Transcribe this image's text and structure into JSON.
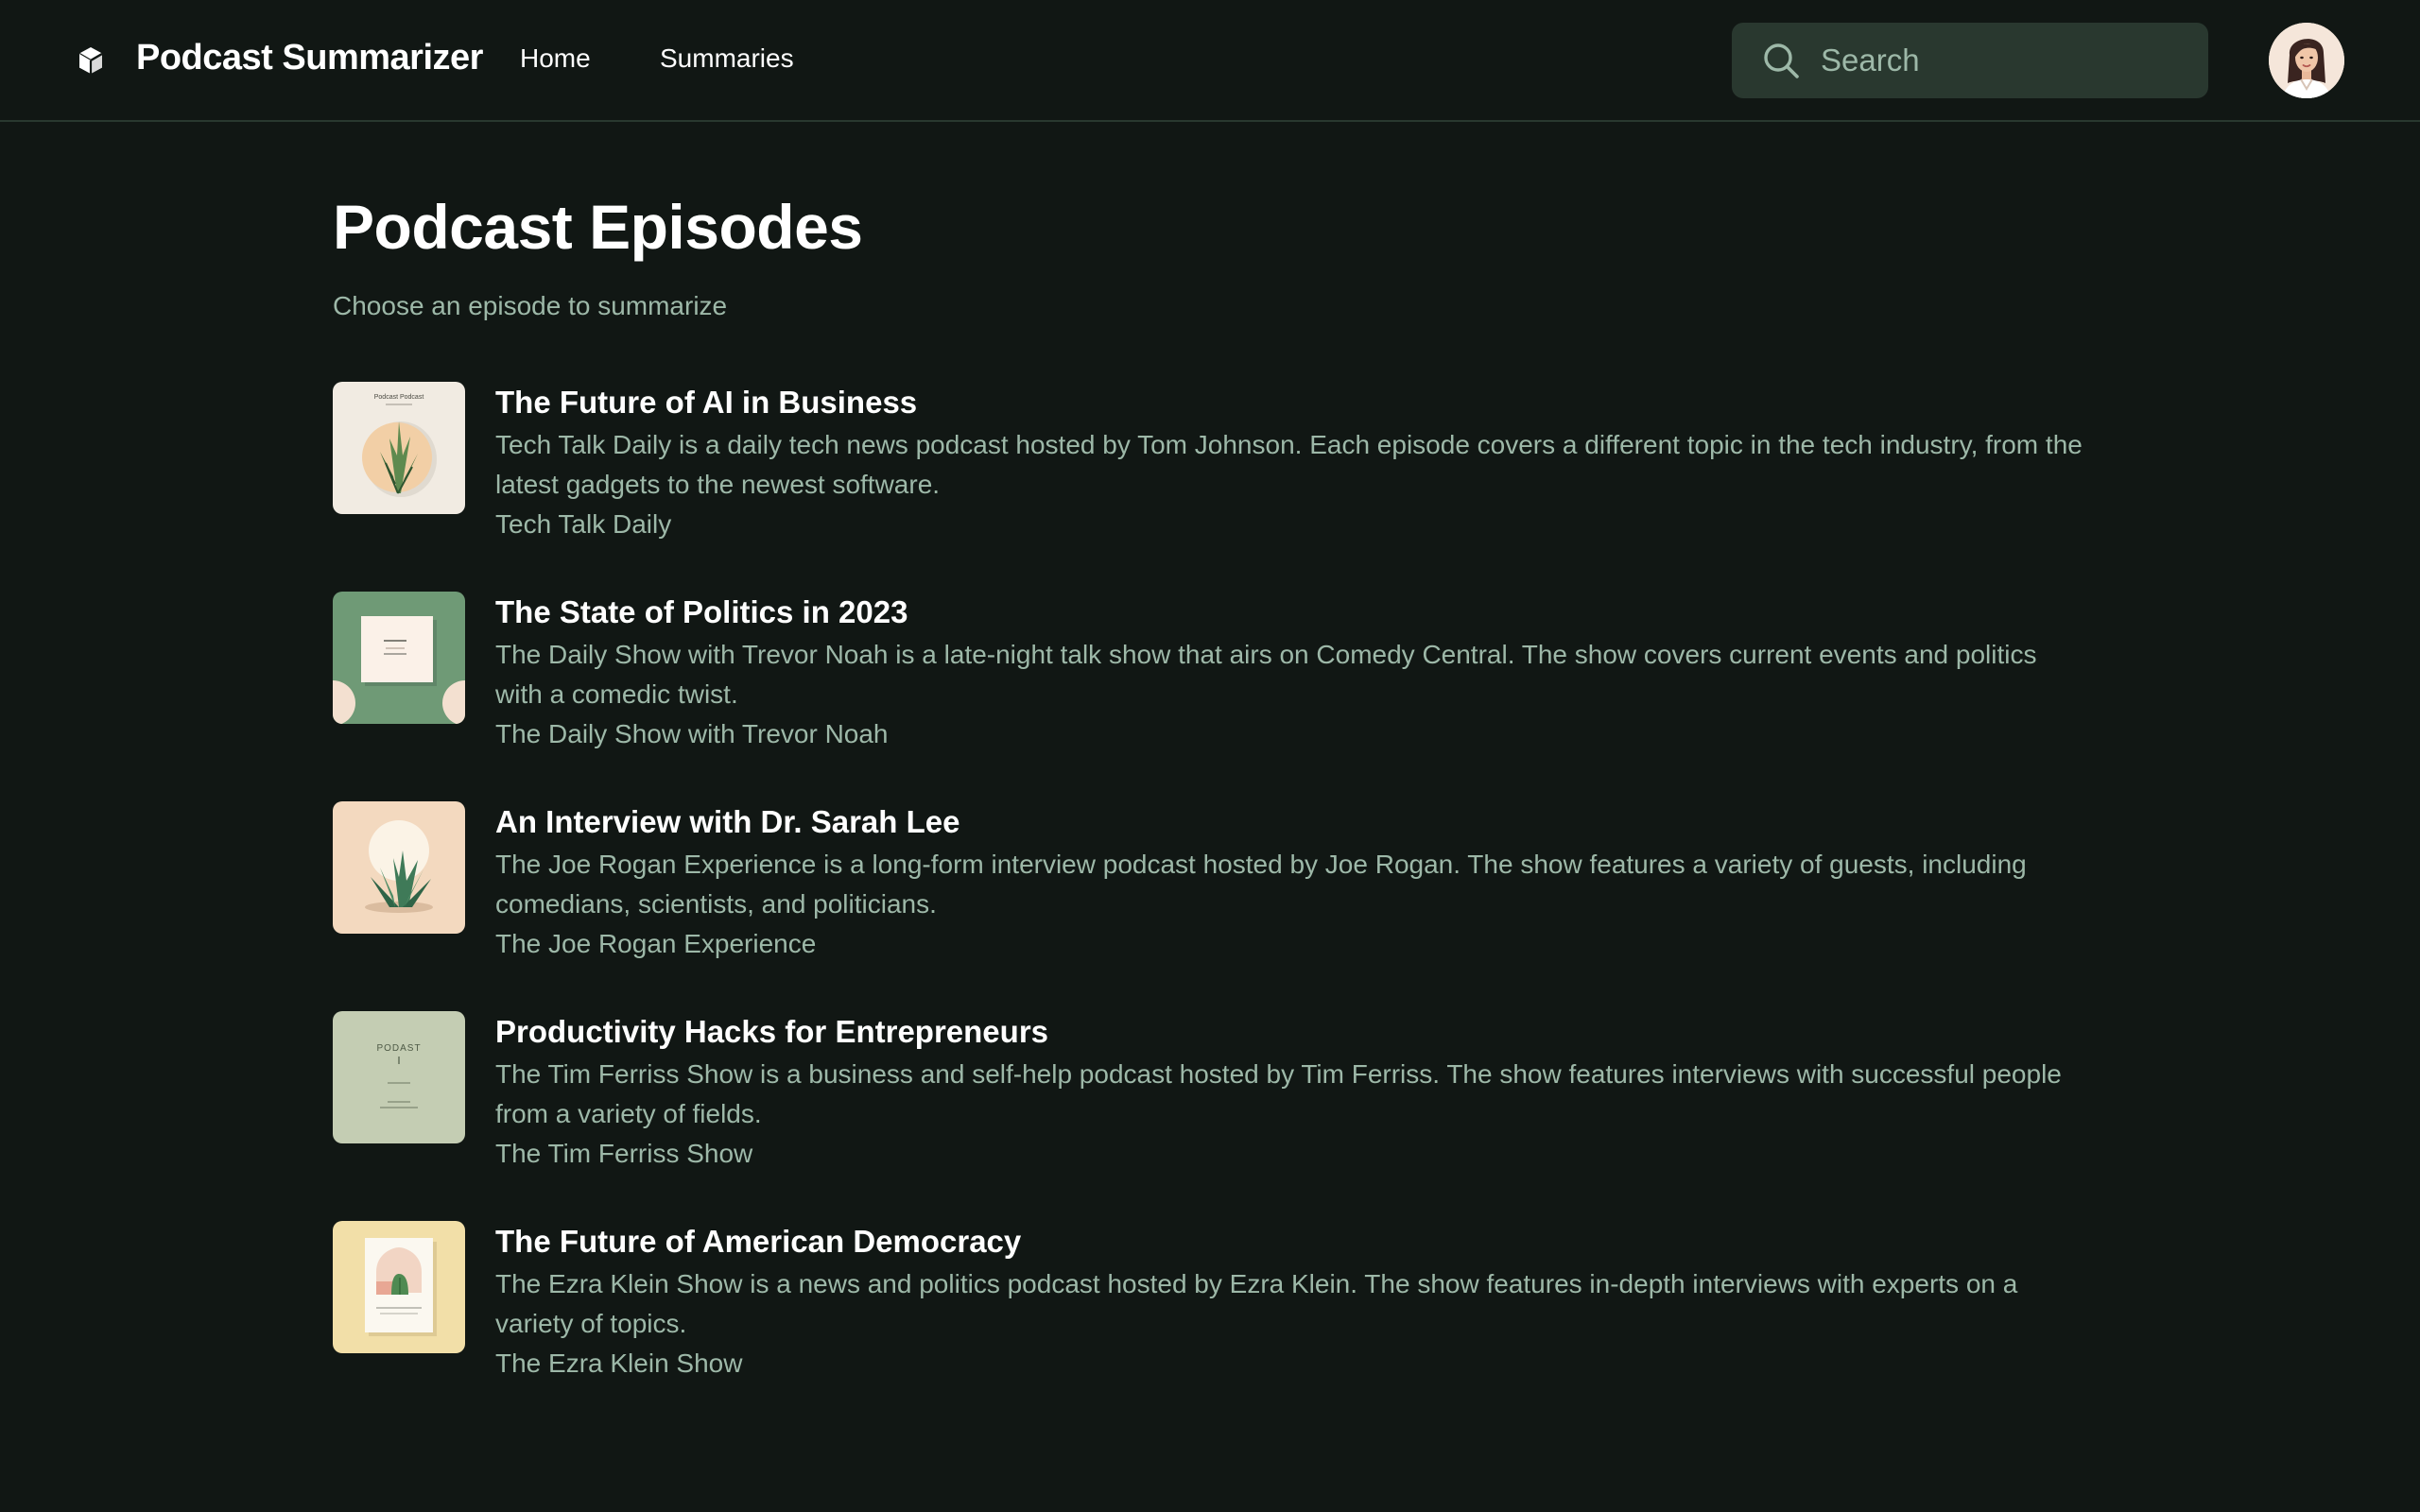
{
  "app": {
    "title": "Podcast Summarizer",
    "icon": "cube-icon"
  },
  "nav": {
    "home_label": "Home",
    "summaries_label": "Summaries"
  },
  "search": {
    "placeholder": "Search",
    "value": "",
    "icon": "search-icon"
  },
  "user": {
    "avatar": "user-avatar"
  },
  "main": {
    "title": "Podcast Episodes",
    "subtitle": "Choose an episode to summarize"
  },
  "episodes": [
    {
      "title": "The Future of AI in Business",
      "description": "Tech Talk Daily is a daily tech news podcast hosted by Tom Johnson. Each episode covers a different topic in the tech industry, from the latest gadgets to the newest software.",
      "show": "Tech Talk Daily",
      "art_label": "Podcast Podcast"
    },
    {
      "title": "The State of Politics in 2023",
      "description": "The Daily Show with Trevor Noah is a late-night talk show that airs on Comedy Central. The show covers current events and politics with a comedic twist.",
      "show": "The Daily Show with Trevor Noah"
    },
    {
      "title": "An Interview with Dr. Sarah Lee",
      "description": "The Joe Rogan Experience is a long-form interview podcast hosted by Joe Rogan. The show features a variety of guests, including comedians, scientists, and politicians.",
      "show": "The Joe Rogan Experience"
    },
    {
      "title": "Productivity Hacks for Entrepreneurs",
      "description": "The Tim Ferriss Show is a business and self-help podcast hosted by Tim Ferriss. The show features interviews with successful people from a variety of fields.",
      "show": "The Tim Ferriss Show",
      "art_label": "PODAST"
    },
    {
      "title": "The Future of American Democracy",
      "description": "The Ezra Klein Show is a news and politics podcast hosted by Ezra Klein. The show features in-depth interviews with experts on a variety of topics.",
      "show": "The Ezra Klein Show"
    }
  ],
  "colors": {
    "background": "#111714",
    "surface": "#29382f",
    "muted_text": "#9db8a8",
    "text": "#ffffff"
  }
}
